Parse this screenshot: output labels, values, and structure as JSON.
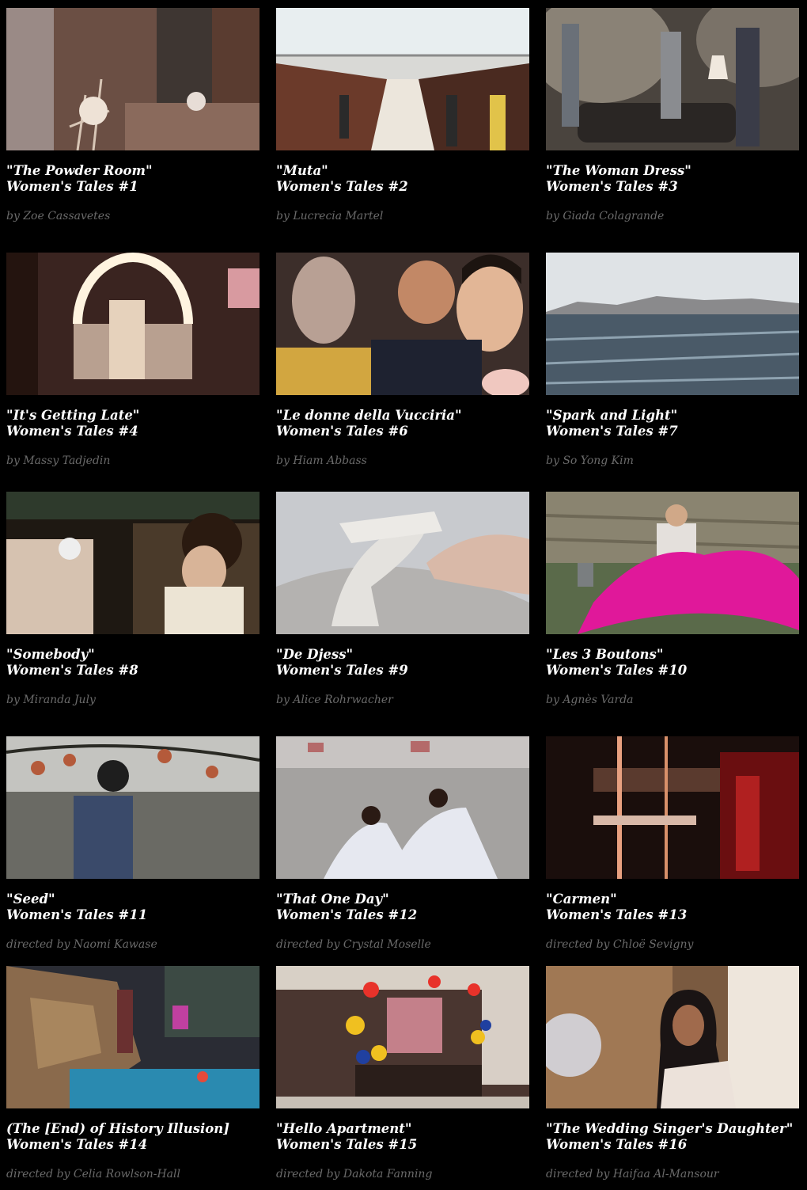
{
  "films": [
    {
      "title": "\"The Powder Room\"",
      "series": "Women's Tales #1",
      "credit": "by Zoe Cassavetes"
    },
    {
      "title": "\"Muta\"",
      "series": "Women's Tales #2",
      "credit": "by Lucrecia Martel"
    },
    {
      "title": "\"The Woman Dress\"",
      "series": "Women's Tales #3",
      "credit": "by Giada Colagrande"
    },
    {
      "title": "\"It's Getting Late\"",
      "series": "Women's Tales #4",
      "credit": "by Massy Tadjedin"
    },
    {
      "title": "\"Le donne della Vucciria\"",
      "series": "Women's Tales #6",
      "credit": "by Hiam Abbass"
    },
    {
      "title": "\"Spark and Light\"",
      "series": "Women's Tales #7",
      "credit": "by So Yong Kim"
    },
    {
      "title": "\"Somebody\"",
      "series": "Women's Tales #8",
      "credit": "by Miranda July"
    },
    {
      "title": "\"De Djess\"",
      "series": "Women's Tales #9",
      "credit": "by Alice Rohrwacher"
    },
    {
      "title": "\"Les 3 Boutons\"",
      "series": "Women's Tales #10",
      "credit": "by Agnès Varda"
    },
    {
      "title": "\"Seed\"",
      "series": "Women's Tales #11",
      "credit": "directed by Naomi Kawase"
    },
    {
      "title": "\"That One Day\"",
      "series": "Women's Tales #12",
      "credit": "directed by Crystal Moselle"
    },
    {
      "title": "\"Carmen\"",
      "series": "Women's Tales #13",
      "credit": "directed by Chloë Sevigny"
    },
    {
      "title": "(The [End) of History Illusion]",
      "series": "Women's Tales #14",
      "credit": "directed by Celia Rowlson-Hall"
    },
    {
      "title": "\"Hello Apartment\"",
      "series": "Women's Tales #15",
      "credit": "directed by Dakota Fanning"
    },
    {
      "title": "\"The Wedding Singer's Daughter\"",
      "series": "Women's Tales #16",
      "credit": "directed by Haifaa Al-Mansour"
    }
  ]
}
